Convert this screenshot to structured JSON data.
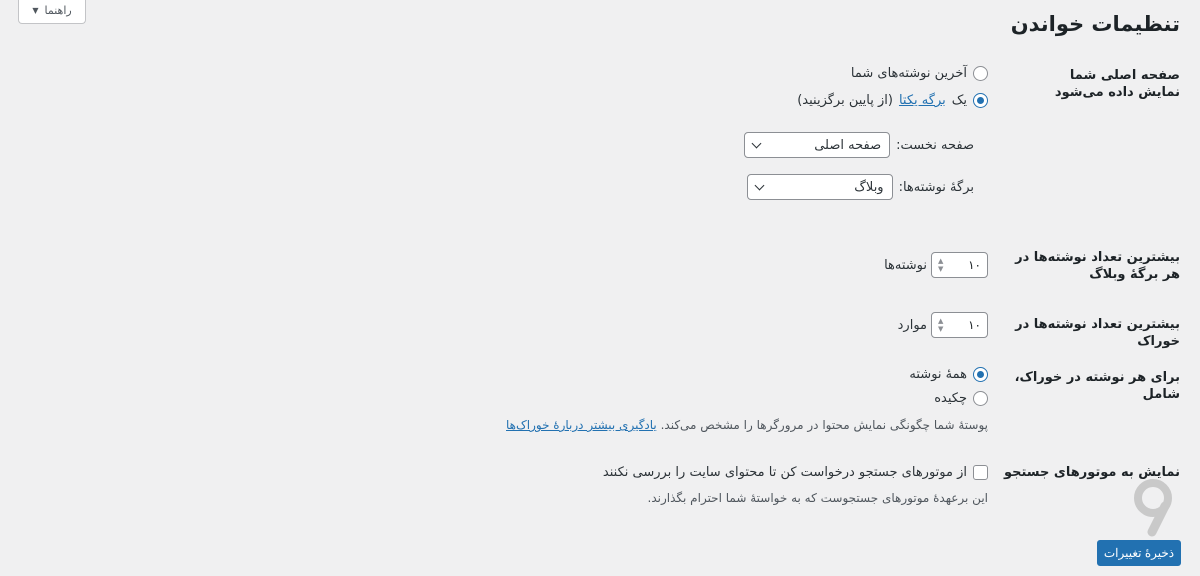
{
  "help_tab": {
    "label": "راهنما"
  },
  "page_title": "تنظیمات خواندن",
  "homepage": {
    "label": "صفحه اصلی شما نمایش داده می‌شود",
    "option_latest": "آخرین نوشته‌های شما",
    "option_static_prefix": "یک",
    "option_static_link": "برگه یکتا",
    "option_static_suffix": "(از پایین برگزینید)",
    "selected": "static",
    "front_page_label": "صفحه نخست:",
    "front_page_value": "صفحه اصلی",
    "posts_page_label": "برگهٔ نوشته‌ها:",
    "posts_page_value": "وبلاگ"
  },
  "posts_per_page": {
    "label": "بیشترین تعداد نوشته‌ها در هر برگهٔ وبلاگ",
    "value": "۱۰",
    "unit": "نوشته‌ها"
  },
  "posts_per_rss": {
    "label": "بیشترین تعداد نوشته‌ها در خوراک",
    "value": "۱۰",
    "unit": "موارد"
  },
  "rss_content": {
    "label": "برای هر نوشته در خوراک، شامل",
    "option_full": "همهٔ نوشته",
    "option_excerpt": "چکیده",
    "selected": "full",
    "description": "پوستهٔ شما چگونگی نمایش محتوا در مرورگرها را مشخص می‌کند.",
    "description_link": "یادگیری بیشتر دربارهٔ خوراک‌ها"
  },
  "search_visibility": {
    "label": "نمایش به موتورهای جستجو",
    "checkbox_label": "از موتورهای جستجو درخواست کن تا محتوای سایت را بررسی نکنند",
    "checked": false,
    "description": "این برعهدهٔ موتورهای جستجوست که به خواستهٔ شما احترام بگذارند."
  },
  "save_button": "ذخیرهٔ تغییرات",
  "colors": {
    "accent": "#2271b1",
    "background": "#f0f0f1",
    "text": "#1d2327"
  }
}
